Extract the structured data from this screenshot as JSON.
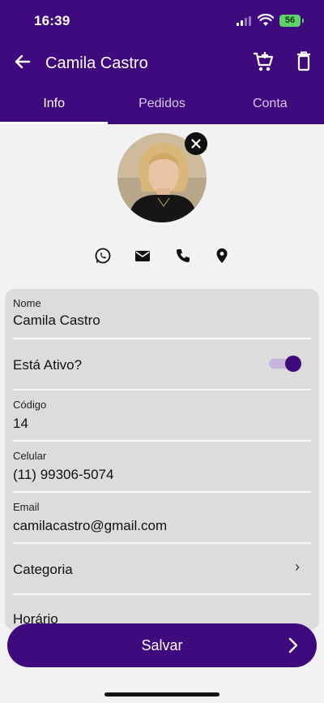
{
  "status": {
    "time": "16:39",
    "battery": "56"
  },
  "toolbar": {
    "title": "Camila Castro"
  },
  "tabs": [
    {
      "label": "Info"
    },
    {
      "label": "Pedidos"
    },
    {
      "label": "Conta"
    }
  ],
  "form": {
    "nome": {
      "label": "Nome",
      "value": "Camila Castro"
    },
    "ativo": {
      "label": "Está Ativo?",
      "on": true
    },
    "codigo": {
      "label": "Código",
      "value": "14"
    },
    "celular": {
      "label": "Celular",
      "value": "(11) 99306-5074"
    },
    "email": {
      "label": "Email",
      "value": "camilacastro@gmail.com"
    },
    "categoria": {
      "label": "Categoria",
      "chevron": "›"
    },
    "next_label": "Horário"
  },
  "save_button": {
    "label": "Salvar"
  },
  "colors": {
    "primary": "#3f0a7e",
    "card": "#dcdcdc",
    "background": "#f2f2f2"
  }
}
